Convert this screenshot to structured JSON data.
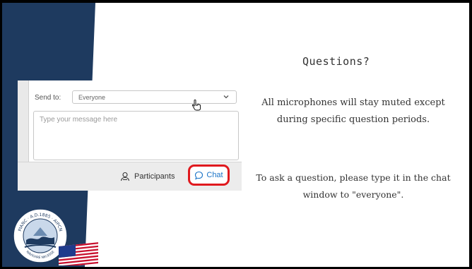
{
  "slide": {
    "title": "Questions?",
    "paragraph1": "All microphones will stay muted except during specific question periods.",
    "paragraph2": "To ask a question, please type it in the chat window to \"everyone\"."
  },
  "chat_panel": {
    "send_to_label": "Send to:",
    "send_to_value": "Everyone",
    "message_placeholder": "Type your message here",
    "participants_label": "Participants",
    "chat_label": "Chat"
  },
  "logo": {
    "top_text": "A.D.1885",
    "left_text": "PIANC",
    "right_text": "AIPCN",
    "bottom_text": "NAVIGARE NECESSE"
  },
  "colors": {
    "band": "#1e3a5f",
    "highlight": "#e0191e",
    "chat_blue": "#1a73c7"
  },
  "icons": [
    "chevron-down-icon",
    "person-icon",
    "chat-bubble-icon",
    "hand-cursor-icon",
    "us-flag-icon"
  ]
}
